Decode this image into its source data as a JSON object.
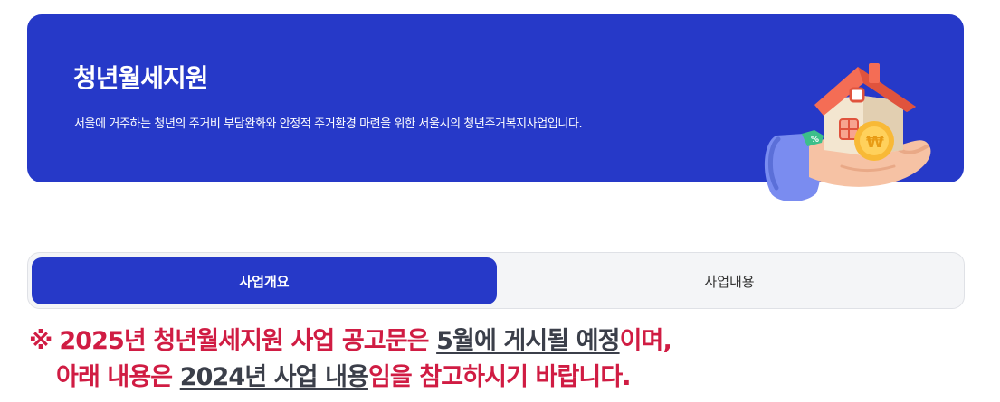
{
  "banner": {
    "title": "청년월세지원",
    "description": "서울에 거주하는 청년의 주거비 부담완화와 안정적 주거환경 마련을 위한 서울시의 청년주거복지사업입니다.",
    "illustration_icon": "hand-holding-house-icon",
    "badge_text": "%",
    "coin_text": "₩",
    "background_color": "#2639c8"
  },
  "tabs": [
    {
      "label": "사업개요",
      "active": true
    },
    {
      "label": "사업내용",
      "active": false
    }
  ],
  "notice": {
    "mark": "※",
    "line1_a": "2025년 청년월세지원 사업 공고문은 ",
    "line1_highlight": "5월에 게시될 예정",
    "line1_b": "이며,",
    "line2_a": "아래 내용은 ",
    "line2_highlight": "2024년 사업 내용",
    "line2_b": "임을 참고하시기 바랍니다.",
    "color": "#d01c43",
    "highlight_color": "#3b3f4a"
  }
}
